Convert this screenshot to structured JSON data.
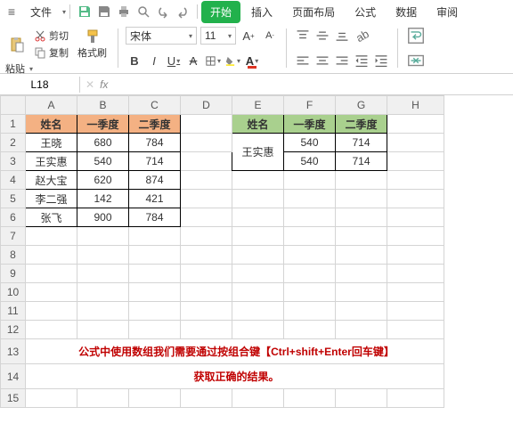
{
  "tabs": {
    "menu": "≡",
    "file": "文件",
    "start": "开始",
    "insert": "插入",
    "layout": "页面布局",
    "formula": "公式",
    "data": "数据",
    "review": "审阅"
  },
  "clipboard": {
    "paste": "粘贴",
    "cut": "剪切",
    "copy": "复制",
    "format_painter": "格式刷"
  },
  "font": {
    "name": "宋体",
    "size": "11"
  },
  "namebox": "L18",
  "cols": [
    "A",
    "B",
    "C",
    "D",
    "E",
    "F",
    "G",
    "H"
  ],
  "t1": {
    "headers": [
      "姓名",
      "一季度",
      "二季度"
    ],
    "rows": [
      [
        "王晓",
        "680",
        "784"
      ],
      [
        "王实惠",
        "540",
        "714"
      ],
      [
        "赵大宝",
        "620",
        "874"
      ],
      [
        "李二强",
        "142",
        "421"
      ],
      [
        "张飞",
        "900",
        "784"
      ]
    ]
  },
  "t2": {
    "headers": [
      "姓名",
      "一季度",
      "二季度"
    ],
    "name": "王实惠",
    "rows": [
      [
        "540",
        "714"
      ],
      [
        "540",
        "714"
      ]
    ]
  },
  "note1": "公式中使用数组我们需要通过按组合键【Ctrl+shift+Enter回车键】",
  "note2": "获取正确的结果。",
  "chart_data": {
    "type": "table",
    "tables": [
      {
        "title": "左表",
        "headers": [
          "姓名",
          "一季度",
          "二季度"
        ],
        "rows": [
          [
            "王晓",
            680,
            784
          ],
          [
            "王实惠",
            540,
            714
          ],
          [
            "赵大宝",
            620,
            874
          ],
          [
            "李二强",
            142,
            421
          ],
          [
            "张飞",
            900,
            784
          ]
        ]
      },
      {
        "title": "右表",
        "headers": [
          "姓名",
          "一季度",
          "二季度"
        ],
        "rows": [
          [
            "王实惠",
            540,
            714
          ],
          [
            "王实惠",
            540,
            714
          ]
        ]
      }
    ]
  }
}
